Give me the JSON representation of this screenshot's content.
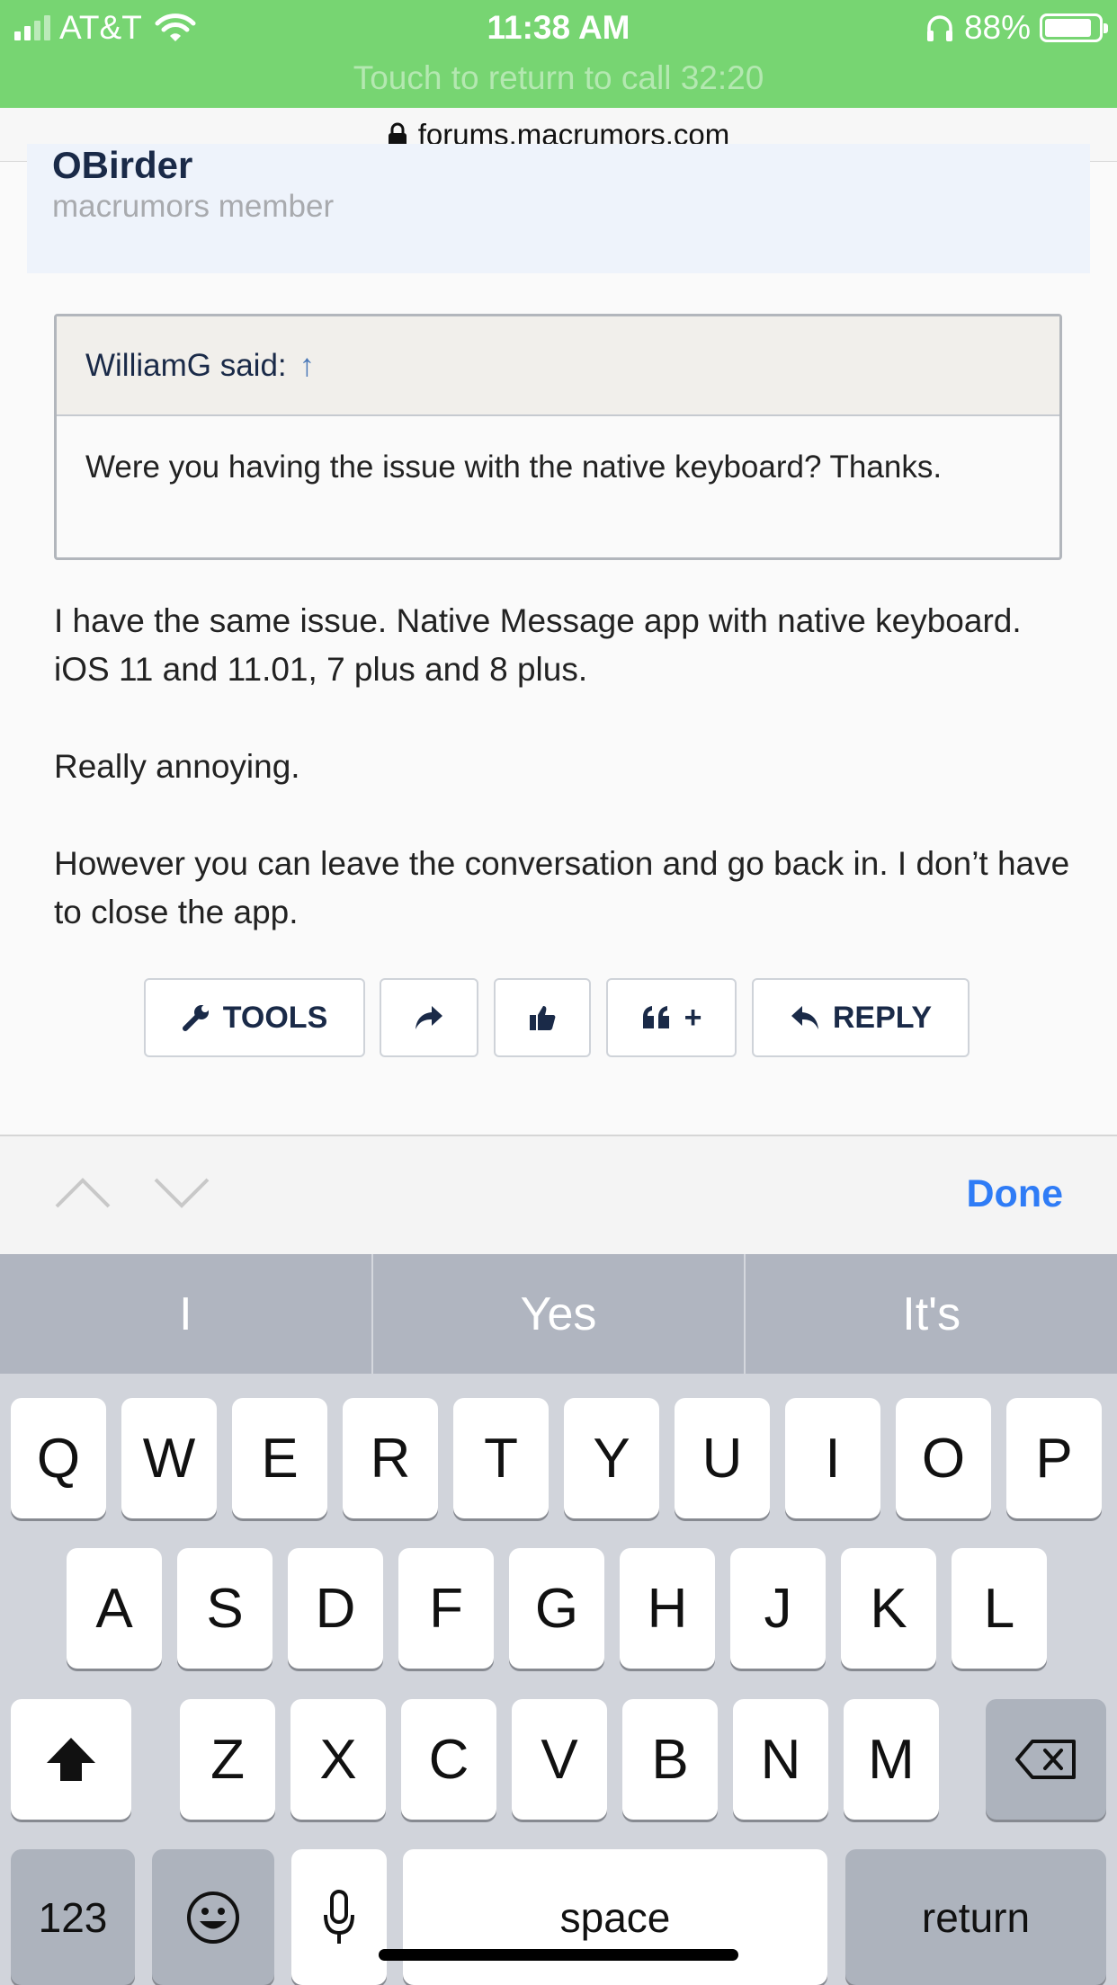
{
  "status_bar": {
    "carrier": "AT&T",
    "time": "11:38 AM",
    "battery": "88%",
    "call_banner": "Touch to return to call 32:20"
  },
  "browser": {
    "url": "forums.macrumors.com"
  },
  "user": {
    "name": "OBirder",
    "title": "macrumors member"
  },
  "quote": {
    "author_line": "WilliamG said:",
    "arrow": "↑",
    "text": "Were you having the issue with the native keyboard? Thanks."
  },
  "post": {
    "paragraphs": [
      "I have the same issue. Native Message app with native keyboard. iOS 11 and 11.01, 7 plus and 8 plus.",
      "Really annoying.",
      "However you can leave the conversation and go back in. I don’t have to close the app."
    ]
  },
  "actions": {
    "tools": "TOOLS",
    "quote_plus": "+",
    "reply": "REPLY"
  },
  "accessory": {
    "done": "Done"
  },
  "keyboard": {
    "predictions": [
      "I",
      "Yes",
      "It's"
    ],
    "row1": [
      "Q",
      "W",
      "E",
      "R",
      "T",
      "Y",
      "U",
      "I",
      "O",
      "P"
    ],
    "row2": [
      "A",
      "S",
      "D",
      "F",
      "G",
      "H",
      "J",
      "K",
      "L"
    ],
    "row3": [
      "Z",
      "X",
      "C",
      "V",
      "B",
      "N",
      "M"
    ],
    "numbers": "123",
    "space": "space",
    "return": "return"
  }
}
